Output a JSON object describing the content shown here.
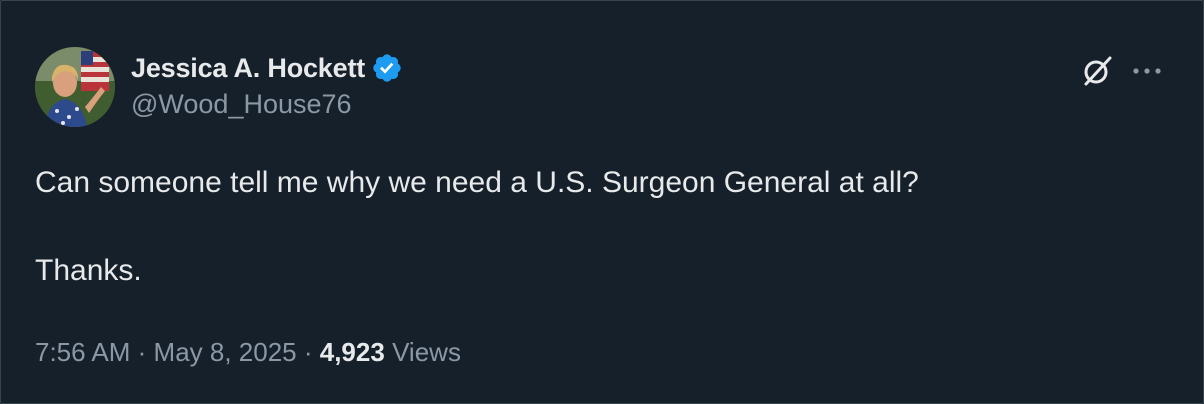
{
  "author": {
    "name": "Jessica A. Hockett",
    "handle": "@Wood_House76",
    "verified": true
  },
  "tweet": {
    "line1": "Can someone tell me why we need a U.S. Surgeon General at all?",
    "line2": "Thanks."
  },
  "meta": {
    "time": "7:56 AM",
    "separator1": "·",
    "date": "May 8, 2025",
    "separator2": "·",
    "views_count": "4,923",
    "views_label": "Views"
  },
  "colors": {
    "background": "#15202b",
    "text": "#e7e9ea",
    "secondary": "#8b98a5",
    "verified": "#1d9bf0"
  },
  "icons": {
    "grok": "grok-icon",
    "more": "more-icon",
    "verified": "verified-badge-icon"
  }
}
